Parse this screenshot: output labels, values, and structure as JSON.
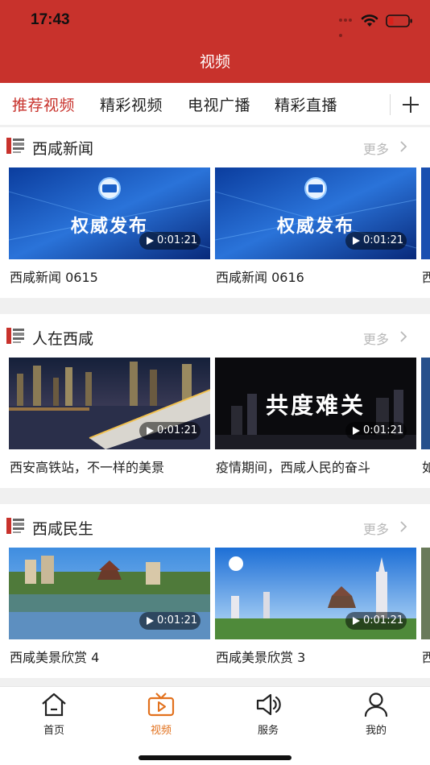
{
  "status_bar": {
    "time": "17:43"
  },
  "header": {
    "title": "视频"
  },
  "tabs": [
    {
      "label": "推荐视频",
      "active": true
    },
    {
      "label": "精彩视频",
      "active": false
    },
    {
      "label": "电视广播",
      "active": false
    },
    {
      "label": "精彩直播",
      "active": false
    }
  ],
  "more_label": "更多",
  "sections": [
    {
      "title": "西咸新闻",
      "videos": [
        {
          "thumb_text": "权威发布",
          "duration": "0:01:21",
          "caption": "西咸新闻 0615"
        },
        {
          "thumb_text": "权威发布",
          "duration": "0:01:21",
          "caption": "西咸新闻 0616"
        },
        {
          "caption": "西"
        }
      ]
    },
    {
      "title": "人在西咸",
      "videos": [
        {
          "duration": "0:01:21",
          "caption": "西安高铁站，不一样的美景"
        },
        {
          "thumb_text": "共度难关",
          "duration": "0:01:21",
          "caption": "疫情期间，西咸人民的奋斗"
        },
        {
          "caption": "如"
        }
      ]
    },
    {
      "title": "西咸民生",
      "videos": [
        {
          "duration": "0:01:21",
          "caption": "西咸美景欣赏 4"
        },
        {
          "duration": "0:01:21",
          "caption": "西咸美景欣赏 3"
        },
        {
          "caption": "西"
        }
      ]
    }
  ],
  "bottom_nav": [
    {
      "label": "首页",
      "icon": "home-icon",
      "active": false
    },
    {
      "label": "视频",
      "icon": "video-icon",
      "active": true
    },
    {
      "label": "服务",
      "icon": "speaker-icon",
      "active": false
    },
    {
      "label": "我的",
      "icon": "user-icon",
      "active": false
    }
  ],
  "colors": {
    "brand_red": "#c8322c",
    "active_tab": "#c8322c",
    "nav_active": "#e2711d",
    "separator": "#f0f0f0"
  }
}
